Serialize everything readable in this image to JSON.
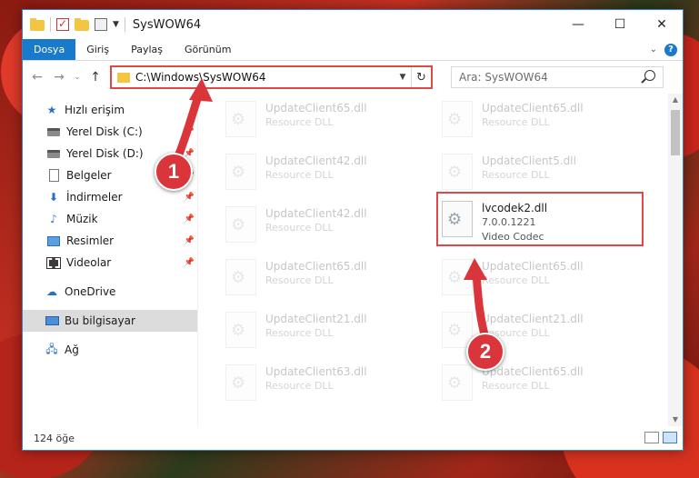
{
  "window": {
    "title": "SysWOW64"
  },
  "ribbon": {
    "tabs": [
      "Dosya",
      "Giriş",
      "Paylaş",
      "Görünüm"
    ],
    "help": "?"
  },
  "address": {
    "path": "C:\\Windows\\SysWOW64",
    "search_placeholder": "Ara: SysWOW64"
  },
  "nav": {
    "quick_access": "Hızlı erişim",
    "items": [
      "Yerel Disk (C:)",
      "Yerel Disk (D:)",
      "Belgeler",
      "İndirmeler",
      "Müzik",
      "Resimler",
      "Videolar"
    ],
    "onedrive": "OneDrive",
    "this_pc": "Bu bilgisayar",
    "network": "Ağ"
  },
  "files": [
    {
      "name": "UpdateClient65.dll",
      "type": "Resource DLL"
    },
    {
      "name": "UpdateClient65.dll",
      "type": "Resource DLL"
    },
    {
      "name": "UpdateClient42.dll",
      "type": "Resource DLL"
    },
    {
      "name": "UpdateClient5.dll",
      "type": "Resource DLL"
    },
    {
      "name": "UpdateClient42.dll",
      "type": "Resource DLL"
    },
    {
      "name": "lvcodek2.dll",
      "version": "7.0.0.1221",
      "type": "Video Codec"
    },
    {
      "name": "UpdateClient65.dll",
      "type": "Resource DLL"
    },
    {
      "name": "UpdateClient65.dll",
      "type": "Resource DLL"
    },
    {
      "name": "UpdateClient21.dll",
      "type": "Resource DLL"
    },
    {
      "name": "UpdateClient21.dll",
      "type": "Resource DLL"
    },
    {
      "name": "UpdateClient63.dll",
      "type": "Resource DLL"
    },
    {
      "name": "UpdateClient65.dll",
      "type": "Resource DLL"
    }
  ],
  "status": {
    "count": "124 öğe"
  },
  "annotations": {
    "step1": "1",
    "step2": "2",
    "color": "#d9353a"
  }
}
